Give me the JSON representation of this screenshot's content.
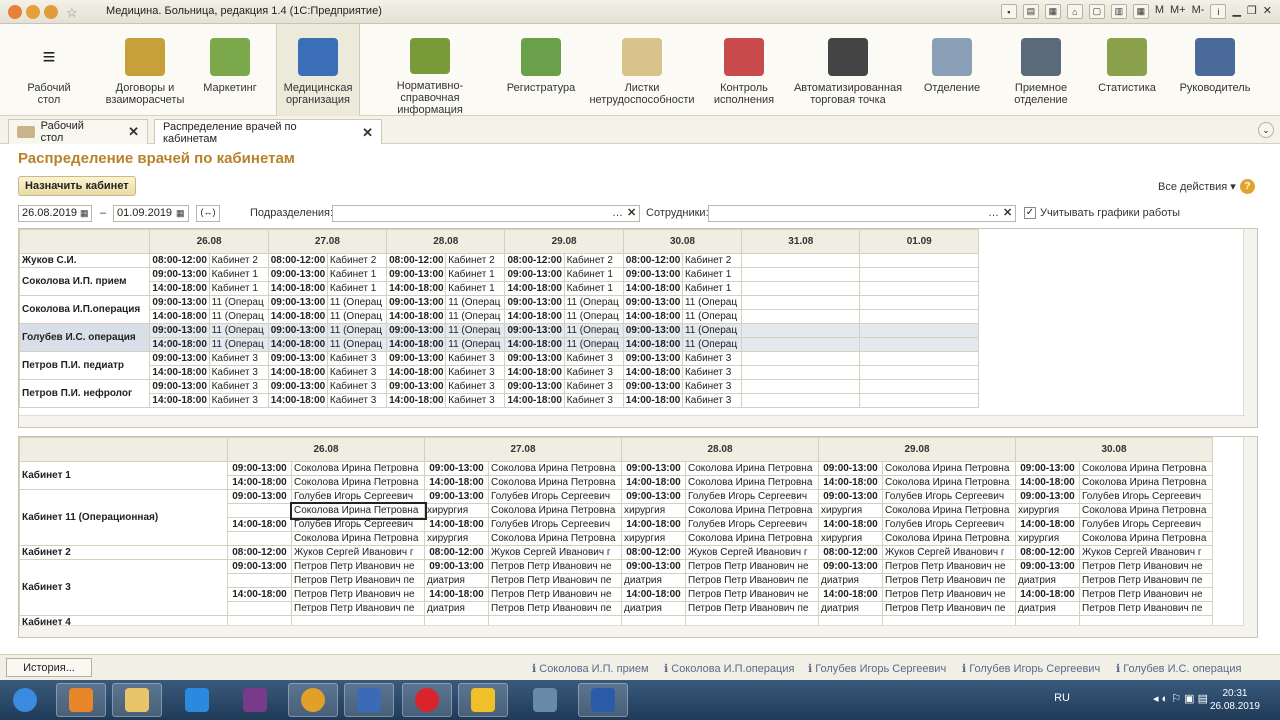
{
  "window": {
    "title": "Медицина. Больница, редакция 1.4  (1С:Предприятие)",
    "right_buttons": [
      "M",
      "M+",
      "M-"
    ]
  },
  "sections": [
    {
      "label": "Рабочий\nстол",
      "icon": "menu-icon"
    },
    {
      "label": "Договоры и\nвзаиморасчеты",
      "icon": "coins-icon"
    },
    {
      "label": "Маркетинг",
      "icon": "pie-chart-icon"
    },
    {
      "label": "Медицинская\nорганизация",
      "icon": "building-icon"
    },
    {
      "label": "Нормативно-справочная\nинформация",
      "icon": "books-icon"
    },
    {
      "label": "Регистратура",
      "icon": "clipboard-icon"
    },
    {
      "label": "Листки\nнетрудоспособности",
      "icon": "documents-icon"
    },
    {
      "label": "Контроль\nисполнения",
      "icon": "first-aid-icon"
    },
    {
      "label": "Автоматизированная\nторговая точка",
      "icon": "cash-register-icon"
    },
    {
      "label": "Отделение",
      "icon": "hospital-bed-icon"
    },
    {
      "label": "Приемное\nотделение",
      "icon": "reception-icon"
    },
    {
      "label": "Статистика",
      "icon": "statistics-icon"
    },
    {
      "label": "Руководитель",
      "icon": "person-icon"
    }
  ],
  "tabs": [
    {
      "label": "Рабочий стол"
    },
    {
      "label": "Распределение врачей по кабинетам"
    }
  ],
  "form": {
    "title": "Распределение врачей по кабинетам",
    "assign_button": "Назначить кабинет",
    "all_actions": "Все действия",
    "date_from": "26.08.2019",
    "date_to": "01.09.2019",
    "dash": "–",
    "period_button": "(↔)",
    "departments_label": "Подразделения:",
    "employees_label": "Сотрудники:",
    "schedule_checkbox_label": "Учитывать графики работы",
    "schedule_checked": true
  },
  "doctors_grid": {
    "days": [
      "26.08",
      "27.08",
      "28.08",
      "29.08",
      "30.08",
      "31.08",
      "01.09"
    ],
    "rows": [
      {
        "name": "Жуков С.И.",
        "slots": [
          [
            "08:00-12:00",
            "Кабинет 2",
            "08:00-12:00",
            "Кабинет 2",
            "08:00-12:00",
            "Кабинет 2",
            "08:00-12:00",
            "Кабинет 2",
            "08:00-12:00",
            "Кабинет 2"
          ]
        ]
      },
      {
        "name": "Соколова И.П. прием",
        "slots": [
          [
            "09:00-13:00",
            "Кабинет 1",
            "09:00-13:00",
            "Кабинет 1",
            "09:00-13:00",
            "Кабинет 1",
            "09:00-13:00",
            "Кабинет 1",
            "09:00-13:00",
            "Кабинет 1"
          ],
          [
            "14:00-18:00",
            "Кабинет 1",
            "14:00-18:00",
            "Кабинет 1",
            "14:00-18:00",
            "Кабинет 1",
            "14:00-18:00",
            "Кабинет 1",
            "14:00-18:00",
            "Кабинет 1"
          ]
        ]
      },
      {
        "name": "Соколова И.П.операция",
        "slots": [
          [
            "09:00-13:00",
            "11 (Операц",
            "09:00-13:00",
            "11 (Операц",
            "09:00-13:00",
            "11 (Операц",
            "09:00-13:00",
            "11 (Операц",
            "09:00-13:00",
            "11 (Операц"
          ],
          [
            "14:00-18:00",
            "11 (Операц",
            "14:00-18:00",
            "11 (Операц",
            "14:00-18:00",
            "11 (Операц",
            "14:00-18:00",
            "11 (Операц",
            "14:00-18:00",
            "11 (Операц"
          ]
        ]
      },
      {
        "name": "Голубев И.С. операция",
        "selected": true,
        "slots": [
          [
            "09:00-13:00",
            "11 (Операц",
            "09:00-13:00",
            "11 (Операц",
            "09:00-13:00",
            "11 (Операц",
            "09:00-13:00",
            "11 (Операц",
            "09:00-13:00",
            "11 (Операц"
          ],
          [
            "14:00-18:00",
            "11 (Операц",
            "14:00-18:00",
            "11 (Операц",
            "14:00-18:00",
            "11 (Операц",
            "14:00-18:00",
            "11 (Операц",
            "14:00-18:00",
            "11 (Операц"
          ]
        ]
      },
      {
        "name": "Петров П.И. педиатр",
        "slots": [
          [
            "09:00-13:00",
            "Кабинет 3",
            "09:00-13:00",
            "Кабинет 3",
            "09:00-13:00",
            "Кабинет 3",
            "09:00-13:00",
            "Кабинет 3",
            "09:00-13:00",
            "Кабинет 3"
          ],
          [
            "14:00-18:00",
            "Кабинет 3",
            "14:00-18:00",
            "Кабинет 3",
            "14:00-18:00",
            "Кабинет 3",
            "14:00-18:00",
            "Кабинет 3",
            "14:00-18:00",
            "Кабинет 3"
          ]
        ]
      },
      {
        "name": "Петров П.И. нефролог",
        "slots": [
          [
            "09:00-13:00",
            "Кабинет 3",
            "09:00-13:00",
            "Кабинет 3",
            "09:00-13:00",
            "Кабинет 3",
            "09:00-13:00",
            "Кабинет 3",
            "09:00-13:00",
            "Кабинет 3"
          ],
          [
            "14:00-18:00",
            "Кабинет 3",
            "14:00-18:00",
            "Кабинет 3",
            "14:00-18:00",
            "Кабинет 3",
            "14:00-18:00",
            "Кабинет 3",
            "14:00-18:00",
            "Кабинет 3"
          ]
        ]
      }
    ]
  },
  "rooms_grid": {
    "days": [
      "26.08",
      "27.08",
      "28.08",
      "29.08",
      "30.08"
    ],
    "rows": [
      {
        "room": "Кабинет 1",
        "lines": [
          [
            "09:00-13:00",
            "Соколова Ирина Петровна"
          ],
          [
            "14:00-18:00",
            "Соколова Ирина Петровна"
          ]
        ]
      },
      {
        "room": "Кабинет 11 (Операционная)",
        "lines": [
          [
            "09:00-13:00",
            "Голубев Игорь Сергеевич"
          ],
          [
            "",
            "Соколова Ирина Петровна",
            "хирургия"
          ],
          [
            "14:00-18:00",
            "Голубев Игорь Сергеевич"
          ],
          [
            "",
            "Соколова Ирина Петровна",
            "хирургия"
          ]
        ]
      },
      {
        "room": "Кабинет 2",
        "lines": [
          [
            "08:00-12:00",
            "Жуков Сергей Иванович г"
          ]
        ]
      },
      {
        "room": "Кабинет 3",
        "lines": [
          [
            "09:00-13:00",
            "Петров Петр Иванович не"
          ],
          [
            "",
            "Петров Петр Иванович пе",
            "диатрия"
          ],
          [
            "14:00-18:00",
            "Петров Петр Иванович не"
          ],
          [
            "",
            "Петров Петр Иванович пе",
            "диатрия"
          ]
        ]
      },
      {
        "room": "Кабинет 4",
        "lines": []
      }
    ]
  },
  "status": {
    "history_button": "История...",
    "links": [
      "Соколова И.П. прием",
      "Соколова И.П.операция",
      "Голубев Игорь Сергеевич",
      "Голубев Игорь Сергеевич",
      "Голубев И.С. операция"
    ]
  },
  "taskbar": {
    "apps": [
      "start-orb-icon",
      "media-player-icon",
      "file-explorer-icon",
      "internet-explorer-icon",
      "messenger-icon",
      "chrome-icon",
      "thunderbird-icon",
      "opera-icon",
      "1c-icon",
      "calculator-icon",
      "word-icon"
    ],
    "lang": "RU",
    "time": "20:31",
    "date": "26.08.2019"
  }
}
